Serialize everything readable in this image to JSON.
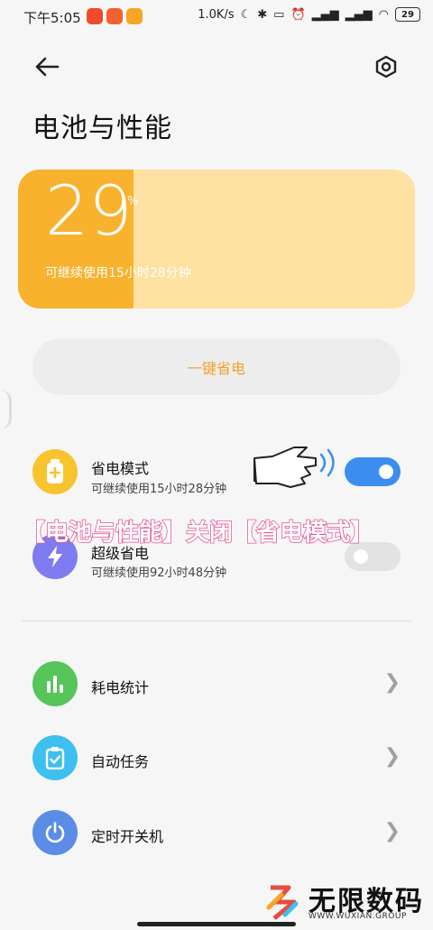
{
  "status_bar": {
    "time": "下午5:05",
    "network_speed": "1.0K/s",
    "battery_level": "29",
    "app_icon_colors": [
      "#f04a2a",
      "#f2612f",
      "#f5a623"
    ]
  },
  "header": {
    "back_icon": "arrow-left-icon",
    "settings_icon": "hexagon-gear-icon",
    "title": "电池与性能"
  },
  "battery_card": {
    "percent": "29",
    "percent_sign": "%",
    "fill_fraction": 0.29,
    "remaining": "可继续使用15小时28分钟",
    "fill_color": "#f8b22e",
    "track_color": "#ffe1a2"
  },
  "one_key_save": {
    "label": "一键省电"
  },
  "modes": [
    {
      "title": "省电模式",
      "subtitle": "可继续使用15小时28分钟",
      "icon": "battery-plus-icon",
      "icon_color": "#f8c42d",
      "toggle_on": true
    },
    {
      "title": "超级省电",
      "subtitle": "可继续使用92小时48分钟",
      "icon": "lightning-icon",
      "icon_color": "#7e7cf0",
      "toggle_on": false
    }
  ],
  "overlay_caption": "【电池与性能】关闭【省电模式】",
  "tools": [
    {
      "title": "耗电统计",
      "icon": "bar-chart-icon",
      "icon_color": "#57c55a"
    },
    {
      "title": "自动任务",
      "icon": "clipboard-check-icon",
      "icon_color": "#3ec0ef"
    },
    {
      "title": "定时开关机",
      "icon": "power-icon",
      "icon_color": "#5b8de6"
    }
  ],
  "watermark": {
    "name": "无限数码",
    "site": "WWW.WUXIAN.GROUP"
  },
  "colors": {
    "accent_orange": "#f3a22a",
    "toggle_on": "#3b8ef0",
    "toggle_off": "#e3e3e3"
  }
}
